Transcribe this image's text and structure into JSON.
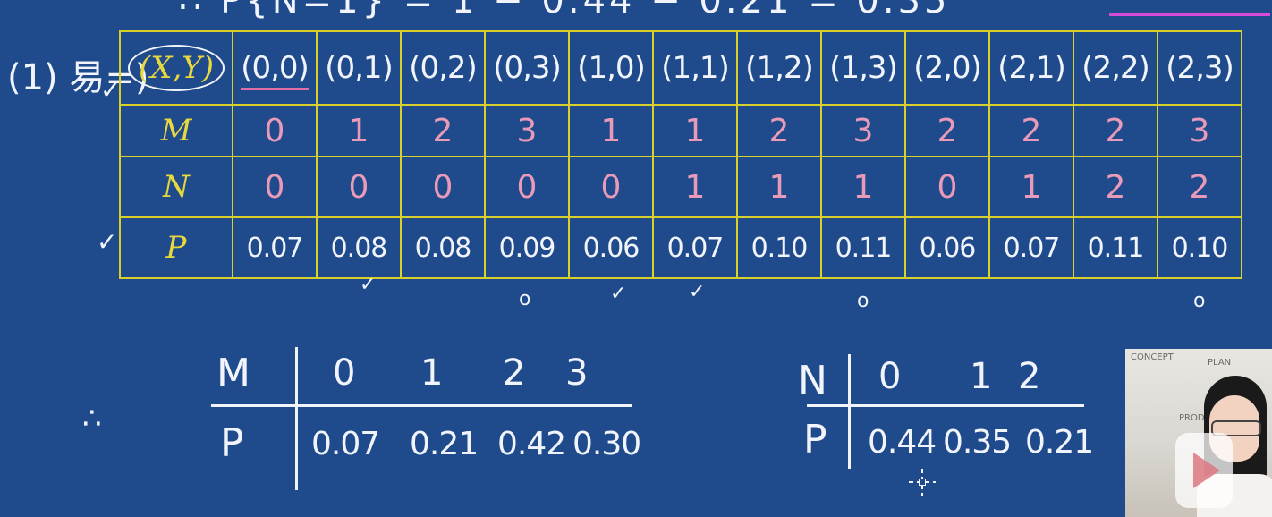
{
  "top_equation": "∴ P{N=1} = 1 − 0.44 − 0.21 = 0.35",
  "left_label": "(1) 易=)",
  "table": {
    "header_labels": [
      "(X,Y)",
      "M",
      "N",
      "P"
    ],
    "pairs": [
      "(0,0)",
      "(0,1)",
      "(0,2)",
      "(0,3)",
      "(1,0)",
      "(1,1)",
      "(1,2)",
      "(1,3)",
      "(2,0)",
      "(2,1)",
      "(2,2)",
      "(2,3)"
    ],
    "M": [
      "0",
      "1",
      "2",
      "3",
      "1",
      "1",
      "2",
      "3",
      "2",
      "2",
      "2",
      "3"
    ],
    "N": [
      "0",
      "0",
      "0",
      "0",
      "0",
      "1",
      "1",
      "1",
      "0",
      "1",
      "2",
      "2"
    ],
    "P": [
      "0.07",
      "0.08",
      "0.08",
      "0.09",
      "0.06",
      "0.07",
      "0.10",
      "0.11",
      "0.06",
      "0.07",
      "0.11",
      "0.10"
    ]
  },
  "below_marks": [
    "✓",
    "o",
    "✓",
    "✓",
    "o",
    "o"
  ],
  "therefore_symbol": "∴",
  "dist_M": {
    "var": "M",
    "prob_label": "P",
    "values": [
      "0",
      "1",
      "2",
      "3"
    ],
    "probs": [
      "0.07",
      "0.21",
      "0.42",
      "0.30"
    ]
  },
  "dist_N": {
    "var": "N",
    "prob_label": "P",
    "values": [
      "0",
      "1",
      "2"
    ],
    "probs": [
      "0.44",
      "0.35",
      "0.21"
    ]
  },
  "webcam_sketch_words": [
    "CONCEPT",
    "PLAN",
    "PRODUCT"
  ],
  "colors": {
    "board": "#1f4a8c",
    "grid": "#d9d02a",
    "chalk": "#f1f4fb",
    "pink": "#e89ab8",
    "yellow": "#e8d840",
    "highlight": "#d84bd8"
  }
}
